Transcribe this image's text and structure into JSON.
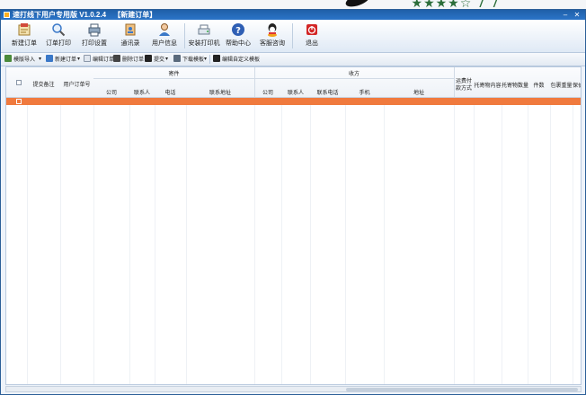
{
  "window": {
    "title": "速打线下用户专用版 V1.0.2.4",
    "subtitle": "【新建订单】"
  },
  "toolbar": {
    "items": [
      {
        "label": "新建订单",
        "icon": "new-order-icon"
      },
      {
        "label": "订单打印",
        "icon": "order-print-icon"
      },
      {
        "label": "打印设置",
        "icon": "print-settings-icon"
      },
      {
        "label": "通讯录",
        "icon": "address-book-icon"
      },
      {
        "label": "用户信息",
        "icon": "user-info-icon"
      },
      {
        "label": "安装打印机",
        "icon": "install-printer-icon"
      },
      {
        "label": "帮助中心",
        "icon": "help-icon"
      },
      {
        "label": "客服咨询",
        "icon": "customer-service-icon"
      },
      {
        "label": "退出",
        "icon": "exit-icon"
      }
    ]
  },
  "actionbar": {
    "batch_import": "模版导入",
    "new_order": "新建订单",
    "edit_order": "编辑订单",
    "delete_order": "删除订单",
    "submit": "提交",
    "download_template": "下载模板",
    "custom_template": "编辑自定义模板"
  },
  "grid": {
    "group_sender": "寄件",
    "group_receiver": "收方",
    "columns": {
      "submit_note": "提交备注",
      "user_order_no": "用户订单号",
      "sender_company": "公司",
      "sender_contact": "联系人",
      "sender_phone": "电话",
      "sender_address": "联系地址",
      "receiver_company": "公司",
      "receiver_contact": "联系人",
      "receiver_phone": "联系电话",
      "receiver_mobile": "手机",
      "receiver_address": "地址",
      "freight_payment": "运费付款方式",
      "goods_content": "托寄物内容",
      "goods_quantity": "托寄物数量",
      "pieces": "件数",
      "package_weight": "包裹重量",
      "extra": "保价"
    }
  },
  "colors": {
    "title_bar": "#2a74c8",
    "selected_row": "#f07a3e",
    "background_stars": "#2c6e3a"
  },
  "background": {
    "stars": "★★★★☆ 7 7"
  }
}
